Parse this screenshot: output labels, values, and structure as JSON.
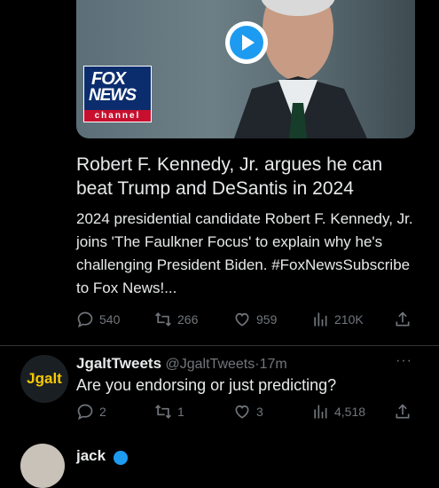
{
  "tweet_card": {
    "channel_logo": {
      "line1": "FOX",
      "line2": "NEWS",
      "line3": "channel"
    },
    "title": "Robert F. Kennedy, Jr. argues he can beat Trump and DeSantis in 2024",
    "description": "2024 presidential candidate Robert F. Kennedy, Jr. joins 'The Faulkner Focus' to explain why he's challenging President Biden. #FoxNewsSubscribe to Fox News!..."
  },
  "tweet_actions": {
    "replies": "540",
    "retweets": "266",
    "likes": "959",
    "views": "210K"
  },
  "reply_tweet": {
    "avatar_text": "Jgalt",
    "display_name": "JgaltTweets",
    "handle": "@JgaltTweets",
    "separator": "·",
    "time": "17m",
    "text": "Are you endorsing or just predicting?",
    "more_label": "···",
    "actions": {
      "replies": "2",
      "retweets": "1",
      "likes": "3",
      "views": "4,518"
    }
  },
  "next_tweet": {
    "display_name": "jack"
  },
  "icons": {
    "reply": "reply-icon",
    "retweet": "retweet-icon",
    "like": "heart-icon",
    "views": "views-icon",
    "share": "share-icon",
    "play": "play-icon",
    "verified": "verified-icon"
  },
  "colors": {
    "background": "#000000",
    "text": "#e7e9ea",
    "muted": "#71767b",
    "accent": "#1d9bf0",
    "divider": "#2f3336",
    "avatar_text": "#f7c900"
  }
}
